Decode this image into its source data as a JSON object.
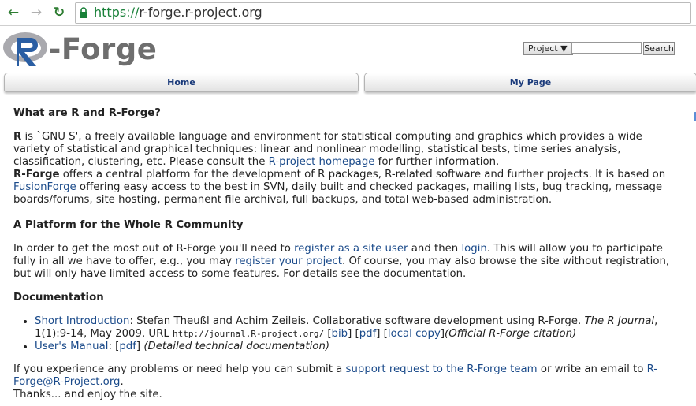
{
  "browser": {
    "url_protocol": "https://",
    "url_host": "r-forge.r-project.org",
    "back_glyph": "←",
    "forward_glyph": "→",
    "reload_glyph": "↻"
  },
  "header": {
    "logo_text": "-Forge",
    "project_select": "Project ▼",
    "search_button": "Search"
  },
  "tabs": {
    "home": "Home",
    "mypage": "My Page"
  },
  "content": {
    "what": {
      "title": "What are R and R-Forge?",
      "r_bold": "R",
      "r_text": " is `GNU S', a freely available language and environment for statistical computing and graphics which provides a wide variety of statistical and graphical techniques: linear and nonlinear modelling, statistical tests, time series analysis, classification, clustering, etc. Please consult the ",
      "r_link": "R-project homepage",
      "r_text2": " for further information.",
      "rf_bold": "R-Forge",
      "rf_text": " offers a central platform for the development of R packages, R-related software and further projects. It is based on ",
      "rf_link": "FusionForge",
      "rf_text2": " offering easy access to the best in SVN, daily built and checked packages, mailing lists, bug tracking, message boards/forums, site hosting, permanent file archival, full backups, and total web-based administration."
    },
    "platform": {
      "title": "A Platform for the Whole R Community",
      "t1": "In order to get the most out of R-Forge you'll need to ",
      "link_register": "register as a site user",
      "t2": " and then ",
      "link_login": "login",
      "t3": ". This will allow you to participate fully in all we have to offer, e.g., you may ",
      "link_project": "register your project",
      "t4": ". Of course, you may also browse the site without registration, but will only have limited access to some features. For details see the documentation."
    },
    "documentation": {
      "title": "Documentation",
      "item1": {
        "link": "Short Introduction",
        "t1": ": Stefan Theußl and Achim Zeileis. Collaborative software development using R-Forge. ",
        "journal": "The R Journal",
        "t2": ", 1(1):9-14, May 2009. URL ",
        "url": "http://journal.R-project.org/",
        "t3": " [",
        "bib": "bib",
        "t4": "] [",
        "pdf": "pdf",
        "t5": "] [",
        "local": "local copy",
        "t6": "]",
        "note": "(Official R-Forge citation)"
      },
      "item2": {
        "link": "User's Manual",
        "t1": ": [",
        "pdf": "pdf",
        "t2": "] ",
        "note": "(Detailed technical documentation)"
      }
    },
    "footer": {
      "t1": "If you experience any problems or need help you can submit a ",
      "link_support": "support request to the R-Forge team",
      "t2": " or write an email to ",
      "link_email": "R-Forge@R-Project.org",
      "t3": ".",
      "thanks": "Thanks... and enjoy the site."
    }
  }
}
